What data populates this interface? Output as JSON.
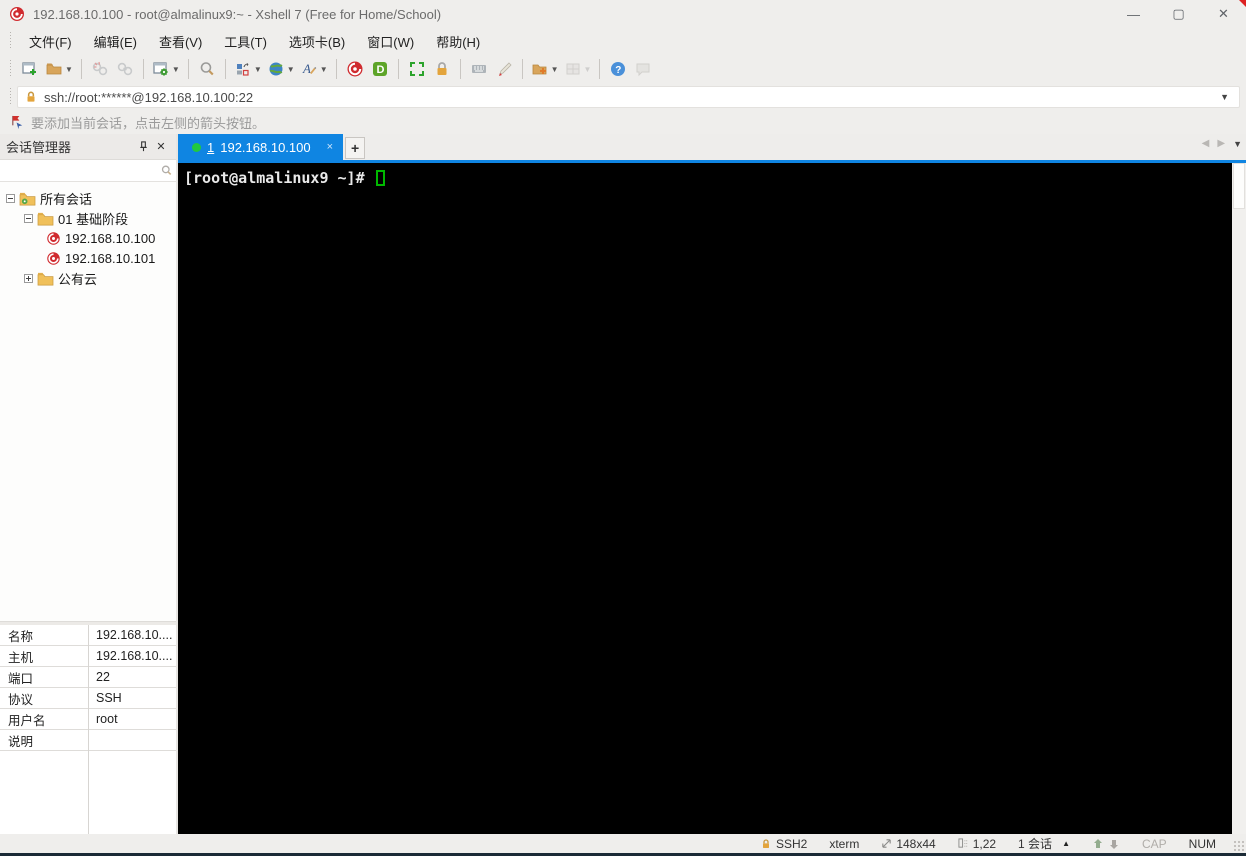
{
  "window": {
    "title": "192.168.10.100 - root@almalinux9:~ - Xshell 7 (Free for Home/School)",
    "controls": {
      "minimize": "—",
      "maximize": "▢",
      "close": "✕"
    }
  },
  "menu": {
    "items": [
      "文件(F)",
      "编辑(E)",
      "查看(V)",
      "工具(T)",
      "选项卡(B)",
      "窗口(W)",
      "帮助(H)"
    ]
  },
  "toolbar": {
    "icons": [
      "new-session",
      "open-folder",
      "disconnect",
      "reconnect",
      "session-properties",
      "find",
      "arrange-layout",
      "web-browser",
      "font",
      "xshell",
      "xftp",
      "fullscreen",
      "lock-screen",
      "virtual-keyboard",
      "highlight-pen",
      "new-folder",
      "layout-grid",
      "help",
      "feedback"
    ]
  },
  "address_bar": {
    "value": "ssh://root:******@192.168.10.100:22"
  },
  "info_bar": {
    "message": "要添加当前会话，点击左侧的箭头按钮。"
  },
  "session_manager": {
    "title": "会话管理器",
    "search_value": "",
    "tree": [
      "所有会话",
      "01 基础阶段",
      "192.168.10.100",
      "192.168.10.101",
      "公有云"
    ]
  },
  "properties": {
    "rows": [
      {
        "label": "名称",
        "value": "192.168.10...."
      },
      {
        "label": "主机",
        "value": "192.168.10...."
      },
      {
        "label": "端口",
        "value": "22"
      },
      {
        "label": "协议",
        "value": "SSH"
      },
      {
        "label": "用户名",
        "value": "root"
      },
      {
        "label": "说明",
        "value": ""
      }
    ]
  },
  "tab_bar": {
    "active_index": "1",
    "active_label": "192.168.10.100",
    "close": "×",
    "new_tab": "+"
  },
  "terminal": {
    "prompt": "[root@almalinux9 ~]# "
  },
  "status_bar": {
    "encryption": "SSH2",
    "terminal_type": "xterm",
    "size": "148x44",
    "cursor_position": "1,22",
    "sessions": "1 会话",
    "cap": "CAP",
    "num": "NUM"
  }
}
